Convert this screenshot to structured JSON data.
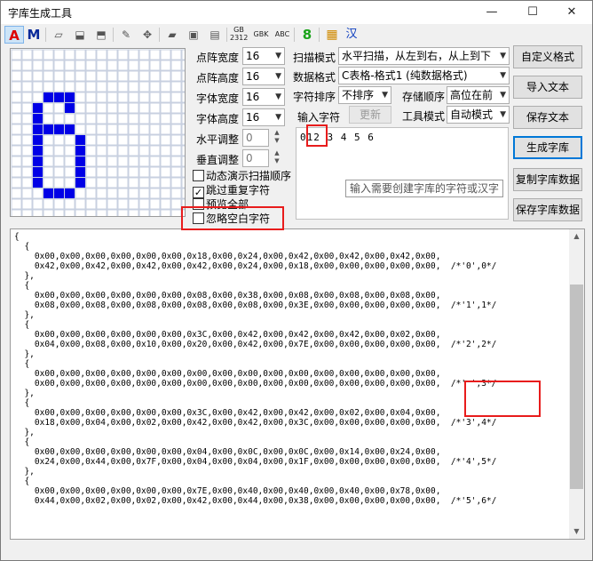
{
  "window": {
    "title": "字库生成工具",
    "minimize_label": "—",
    "maximize_label": "☐",
    "close_label": "✕"
  },
  "toolbar": {
    "items": [
      {
        "name": "font-a-icon",
        "label": "A"
      },
      {
        "name": "font-m-icon",
        "label": "M"
      },
      {
        "name": "eraser-icon",
        "label": "▱"
      },
      {
        "name": "fill-icon",
        "label": "⬓"
      },
      {
        "name": "stamp-icon",
        "label": "⬒"
      },
      {
        "name": "pencil-icon",
        "label": "✎"
      },
      {
        "name": "move-icon",
        "label": "✥"
      },
      {
        "name": "open-folder-icon",
        "label": "▰"
      },
      {
        "name": "save-icon",
        "label": "▣"
      },
      {
        "name": "save-as-icon",
        "label": "▤"
      },
      {
        "name": "gb2312-icon",
        "label": "GB"
      },
      {
        "name": "gbk-icon",
        "label": "GBK"
      },
      {
        "name": "abc-icon",
        "label": "ABC"
      },
      {
        "name": "digit-8-icon",
        "label": "8"
      },
      {
        "name": "grid-color-icon",
        "label": "▦"
      },
      {
        "name": "chinese-char-icon",
        "label": "汉"
      }
    ],
    "gb_sub": "2312"
  },
  "settings": {
    "dot_width_label": "点阵宽度",
    "dot_width_value": "16",
    "dot_height_label": "点阵高度",
    "dot_height_value": "16",
    "font_width_label": "字体宽度",
    "font_width_value": "16",
    "font_height_label": "字体高度",
    "font_height_value": "16",
    "h_adjust_label": "水平调整",
    "h_adjust_value": "0",
    "v_adjust_label": "垂直调整",
    "v_adjust_value": "0",
    "scan_mode_label": "扫描模式",
    "scan_mode_value": "水平扫描，从左到右，从上到下",
    "data_format_label": "数据格式",
    "data_format_value": "C表格-格式1 (纯数据格式)",
    "char_sort_label": "字符排序",
    "char_sort_value": "不排序",
    "storage_order_label": "存储顺序",
    "storage_order_value": "高位在前",
    "input_chars_label": "输入字符",
    "refresh_label": "更新",
    "tool_mode_label": "工具模式",
    "tool_mode_value": "自动模式"
  },
  "checkboxes": [
    {
      "label": "动态演示扫描顺序",
      "checked": false
    },
    {
      "label": "跳过重复字符",
      "checked": true
    },
    {
      "label": "预览全部",
      "checked": false
    },
    {
      "label": "忽略空白字符",
      "checked": false
    }
  ],
  "check_mark": "✓",
  "input": {
    "text": "012 3 4 5 6",
    "tooltip": "输入需要创建字库的字符或汉字"
  },
  "buttons": {
    "custom_format": "自定义格式",
    "import_text": "导入文本",
    "save_text": "保存文本",
    "generate": "生成字库",
    "copy_data": "复制字库数据",
    "save_data": "保存字库数据"
  },
  "output": {
    "lines": [
      "{",
      "  {",
      "    0x00,0x00,0x00,0x00,0x00,0x00,0x18,0x00,0x24,0x00,0x42,0x00,0x42,0x00,0x42,0x00,",
      "    0x42,0x00,0x42,0x00,0x42,0x00,0x42,0x00,0x24,0x00,0x18,0x00,0x00,0x00,0x00,0x00,  /*'0',0*/",
      "  },",
      "  {",
      "    0x00,0x00,0x00,0x00,0x00,0x00,0x08,0x00,0x38,0x00,0x08,0x00,0x08,0x00,0x08,0x00,",
      "    0x08,0x00,0x08,0x00,0x08,0x00,0x08,0x00,0x08,0x00,0x3E,0x00,0x00,0x00,0x00,0x00,  /*'1',1*/",
      "  },",
      "  {",
      "    0x00,0x00,0x00,0x00,0x00,0x00,0x3C,0x00,0x42,0x00,0x42,0x00,0x42,0x00,0x02,0x00,",
      "    0x04,0x00,0x08,0x00,0x10,0x00,0x20,0x00,0x42,0x00,0x7E,0x00,0x00,0x00,0x00,0x00,  /*'2',2*/",
      "  },",
      "  {",
      "    0x00,0x00,0x00,0x00,0x00,0x00,0x00,0x00,0x00,0x00,0x00,0x00,0x00,0x00,0x00,0x00,",
      "    0x00,0x00,0x00,0x00,0x00,0x00,0x00,0x00,0x00,0x00,0x00,0x00,0x00,0x00,0x00,0x00,  /*' ',3*/",
      "  },",
      "  {",
      "    0x00,0x00,0x00,0x00,0x00,0x00,0x3C,0x00,0x42,0x00,0x42,0x00,0x02,0x00,0x04,0x00,",
      "    0x18,0x00,0x04,0x00,0x02,0x00,0x42,0x00,0x42,0x00,0x3C,0x00,0x00,0x00,0x00,0x00,  /*'3',4*/",
      "  },",
      "  {",
      "    0x00,0x00,0x00,0x00,0x00,0x00,0x04,0x00,0x0C,0x00,0x0C,0x00,0x14,0x00,0x24,0x00,",
      "    0x24,0x00,0x44,0x00,0x7F,0x00,0x04,0x00,0x04,0x00,0x1F,0x00,0x00,0x00,0x00,0x00,  /*'4',5*/",
      "  },",
      "  {",
      "    0x00,0x00,0x00,0x00,0x00,0x00,0x7E,0x00,0x40,0x00,0x40,0x00,0x40,0x00,0x78,0x00,",
      "    0x44,0x00,0x02,0x00,0x02,0x00,0x42,0x00,0x44,0x00,0x38,0x00,0x00,0x00,0x00,0x00,  /*'5',6*/"
    ]
  },
  "preview": {
    "grid_cols": 12,
    "grid_rows": 12,
    "fill_color": "#0000e6",
    "grid_color": "#c8d0e0",
    "pixels": [
      [
        3,
        4
      ],
      [
        4,
        4
      ],
      [
        5,
        4
      ],
      [
        2,
        5
      ],
      [
        5,
        5
      ],
      [
        2,
        6
      ],
      [
        2,
        7
      ],
      [
        3,
        7
      ],
      [
        4,
        7
      ],
      [
        5,
        7
      ],
      [
        2,
        8
      ],
      [
        6,
        8
      ],
      [
        2,
        9
      ],
      [
        6,
        9
      ],
      [
        2,
        10
      ],
      [
        6,
        10
      ],
      [
        2,
        11
      ],
      [
        6,
        11
      ],
      [
        2,
        12
      ],
      [
        6,
        12
      ],
      [
        3,
        13
      ],
      [
        4,
        13
      ],
      [
        5,
        13
      ]
    ]
  },
  "colors": {
    "annotation_red": "#e81c1c",
    "accent_blue": "#0078d7"
  }
}
